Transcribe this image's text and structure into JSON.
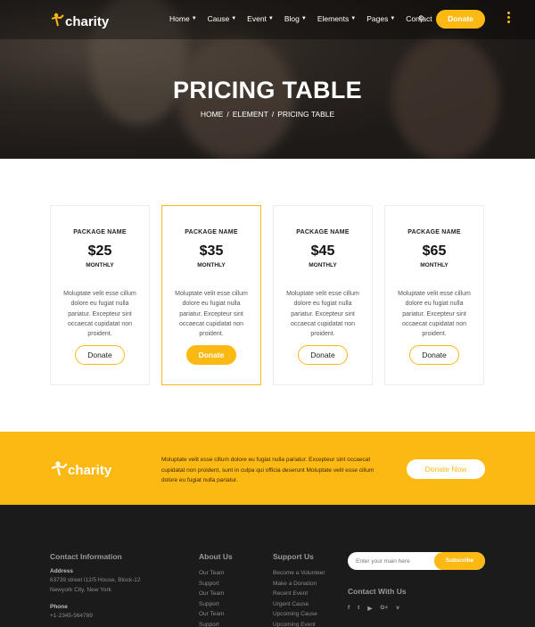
{
  "brand": {
    "name": "charity",
    "accent_color": "#fdb913"
  },
  "nav": {
    "items": [
      {
        "label": "Home",
        "dropdown": true
      },
      {
        "label": "Cause",
        "dropdown": true
      },
      {
        "label": "Event",
        "dropdown": true
      },
      {
        "label": "Blog",
        "dropdown": true
      },
      {
        "label": "Elements",
        "dropdown": true
      },
      {
        "label": "Pages",
        "dropdown": true
      },
      {
        "label": "Contact",
        "dropdown": false
      }
    ],
    "search_icon": "search-icon",
    "donate_label": "Donate",
    "menu_icon": "vertical-dots-icon"
  },
  "hero": {
    "title": "PRICING TABLE",
    "breadcrumb": [
      "HOME",
      "ELEMENT",
      "PRICING TABLE"
    ],
    "separator": "/"
  },
  "pricing": {
    "cards": [
      {
        "name": "PACKAGE NAME",
        "price": "$25",
        "period": "MONTHLY",
        "description": "Moluptate velit esse cillum dolore eu fugiat nulla pariatur. Excepteur sint occaecat cupidatat non proident.",
        "button": "Donate",
        "highlighted": false
      },
      {
        "name": "PACKAGE NAME",
        "price": "$35",
        "period": "MONTHLY",
        "description": "Moluptate velit esse cillum dolore eu fugiat nulla pariatur. Excepteur sint occaecat cupidatat non proident.",
        "button": "Donate",
        "highlighted": true
      },
      {
        "name": "PACKAGE NAME",
        "price": "$45",
        "period": "MONTHLY",
        "description": "Moluptate velit esse cillum dolore eu fugiat nulla pariatur. Excepteur sint occaecat cupidatat non proident.",
        "button": "Donate",
        "highlighted": false
      },
      {
        "name": "PACKAGE NAME",
        "price": "$65",
        "period": "MONTHLY",
        "description": "Moluptate velit esse cillum dolore eu fugiat nulla pariatur. Excepteur sint occaecat cupidatat non proident.",
        "button": "Donate",
        "highlighted": false
      }
    ]
  },
  "cta": {
    "text": "Moluptate velit esse cillum dolore eu fugiat nulla pariatur. Excepteur sint occaecat cupidatat non proident, sunt in culpa qui officia deserunt Moluptate velit esse cillum dolore eu fugiat nulla pariatur.",
    "button": "Donate Now"
  },
  "footer": {
    "contact": {
      "title": "Contact Information",
      "address_label": "Address",
      "address_line1": "63739 street l12/5 House, Block-12",
      "address_line2": "Newyork City, New York",
      "phone_label": "Phone",
      "phone": "+1-2345-564789"
    },
    "about": {
      "title": "About Us",
      "links": [
        "Our Team",
        "Support",
        "Our Team",
        "Support",
        "Our Team",
        "Support"
      ]
    },
    "support": {
      "title": "Support Us",
      "links": [
        "Become a Volunteer",
        "Make a Donation",
        "Recent Event",
        "Urgent Cause",
        "Upcoming Cause",
        "Upcoming Event"
      ]
    },
    "subscribe": {
      "placeholder": "Enter your main here",
      "button": "Subscribe"
    },
    "social": {
      "title": "Contact With Us",
      "icons": [
        {
          "name": "facebook-icon",
          "glyph": "f"
        },
        {
          "name": "twitter-icon",
          "glyph": "t"
        },
        {
          "name": "youtube-icon",
          "glyph": "▶"
        },
        {
          "name": "google-plus-icon",
          "glyph": "G+"
        },
        {
          "name": "vimeo-icon",
          "glyph": "v"
        }
      ]
    }
  }
}
